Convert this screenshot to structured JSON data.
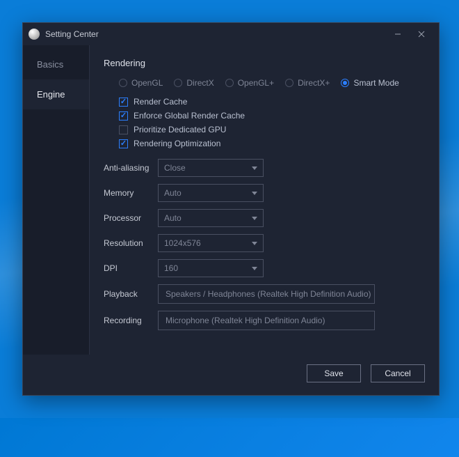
{
  "window": {
    "title": "Setting Center"
  },
  "sidebar": {
    "items": [
      {
        "label": "Basics",
        "active": false
      },
      {
        "label": "Engine",
        "active": true
      }
    ]
  },
  "section": {
    "title": "Rendering"
  },
  "radios": {
    "options": [
      {
        "label": "OpenGL",
        "selected": false
      },
      {
        "label": "DirectX",
        "selected": false
      },
      {
        "label": "OpenGL+",
        "selected": false
      },
      {
        "label": "DirectX+",
        "selected": false
      },
      {
        "label": "Smart Mode",
        "selected": true
      }
    ]
  },
  "checks": [
    {
      "label": "Render Cache",
      "checked": true
    },
    {
      "label": "Enforce Global Render Cache",
      "checked": true
    },
    {
      "label": "Prioritize Dedicated GPU",
      "checked": false
    },
    {
      "label": "Rendering Optimization",
      "checked": true
    }
  ],
  "fields": {
    "anti_aliasing": {
      "label": "Anti-aliasing",
      "value": "Close"
    },
    "memory": {
      "label": "Memory",
      "value": "Auto"
    },
    "processor": {
      "label": "Processor",
      "value": "Auto"
    },
    "resolution": {
      "label": "Resolution",
      "value": "1024x576"
    },
    "dpi": {
      "label": "DPI",
      "value": "160"
    },
    "playback": {
      "label": "Playback",
      "value": "Speakers / Headphones (Realtek High Definition Audio)"
    },
    "recording": {
      "label": "Recording",
      "value": "Microphone (Realtek High Definition Audio)"
    }
  },
  "footer": {
    "save": "Save",
    "cancel": "Cancel"
  }
}
